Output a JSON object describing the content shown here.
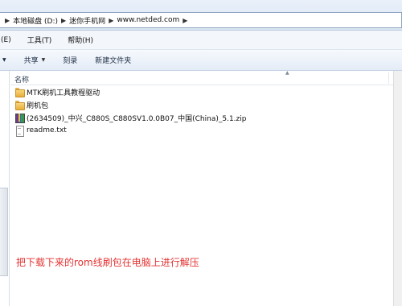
{
  "address_bar": {
    "breadcrumbs": [
      "本地磁盘 (D:)",
      "迷你手机网",
      "www.netded.com"
    ]
  },
  "menu": {
    "items": [
      "(E)",
      "工具(T)",
      "帮助(H)"
    ]
  },
  "toolbar": {
    "share_label": "共享",
    "burn_label": "刻录",
    "new_folder_label": "新建文件夹"
  },
  "file_list": {
    "column_name": "名称",
    "items": [
      {
        "name": "MTK刷机工具教程驱动",
        "type": "folder"
      },
      {
        "name": "刷机包",
        "type": "folder"
      },
      {
        "name": "(2634509)_中兴_C880S_C880SV1.0.0B07_中国(China)_5.1.zip",
        "type": "archive"
      },
      {
        "name": "readme.txt",
        "type": "text"
      }
    ]
  },
  "annotation": "把下载下来的rom线刷包在电脑上进行解压",
  "colors": {
    "annotation": "#e53232"
  }
}
